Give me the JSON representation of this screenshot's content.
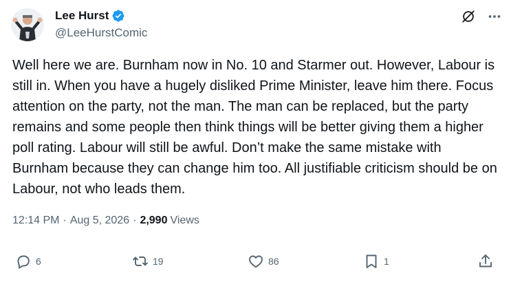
{
  "author": {
    "display_name": "Lee Hurst",
    "handle": "@LeeHurstComic",
    "verified": true
  },
  "tweet": {
    "text": "Well here we are. Burnham now in No. 10 and Starmer out. However, Labour is still in. When you have a hugely disliked Prime Minister, leave him there. Focus attention on the party, not the man. The man can be replaced, but the party remains and some people then think things will be better giving them a higher poll rating. Labour will still be awful. Don’t make the same mistake with Burnham because they can change him too. All justifiable criticism should be on Labour, not who leads them."
  },
  "meta": {
    "time": "12:14 PM",
    "separator": "·",
    "date": "Aug 5, 2026",
    "views_count": "2,990",
    "views_label": "Views"
  },
  "actions": {
    "replies": "6",
    "reposts": "19",
    "likes": "86",
    "bookmarks": "1"
  },
  "colors": {
    "text": "#0f1419",
    "secondary": "#536471",
    "verified": "#1d9bf0"
  },
  "icons": [
    "verified-badge-icon",
    "grok-icon",
    "more-icon",
    "reply-icon",
    "retweet-icon",
    "like-icon",
    "bookmark-icon",
    "share-icon"
  ]
}
